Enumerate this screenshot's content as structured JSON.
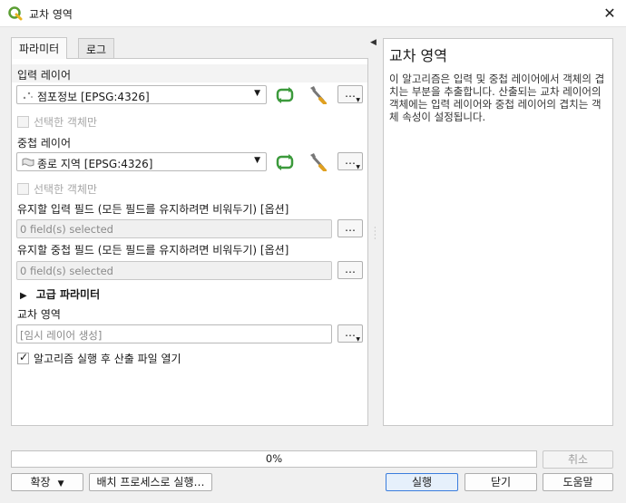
{
  "window": {
    "title": "교차 영역",
    "close_label": "✕"
  },
  "tabs": [
    {
      "label": "파라미터",
      "active": true
    },
    {
      "label": "로그",
      "active": false
    }
  ],
  "params": {
    "input_layer_label": "입력 레이어",
    "input_layer_value": "점포정보 [EPSG:4326]",
    "selected_only_label": "선택한 객체만",
    "overlay_layer_label": "중첩 레이어",
    "overlay_layer_value": "종로 지역 [EPSG:4326]",
    "input_fields_label": "유지할 입력 필드 (모든 필드를 유지하려면 비워두기) [옵션]",
    "input_fields_value": "0 field(s) selected",
    "overlay_fields_label": "유지할 중첩 필드 (모든 필드를 유지하려면 비워두기) [옵션]",
    "overlay_fields_value": "0 field(s) selected",
    "advanced_label": "고급 파라미터",
    "output_label": "교차 영역",
    "output_placeholder": "[임시 레이어 생성]",
    "open_after_label": "알고리즘 실행 후 산출 파일 열기",
    "ellipsis": "…"
  },
  "help": {
    "title": "교차 영역",
    "body": "이 알고리즘은 입력 및 중첩 레이어에서 객체의 겹치는 부분을 추출합니다. 산출되는 교차 레이어의 객체에는 입력 레이어와 중첩 레이어의 겹치는 객체 속성이 설정됩니다."
  },
  "progress": {
    "value": 0,
    "text": "0%"
  },
  "buttons": {
    "cancel": "취소",
    "expand": "확장",
    "batch": "배치 프로세스로 실행…",
    "run": "실행",
    "close": "닫기",
    "help": "도움말"
  },
  "colors": {
    "iterate_green": "#3c9a3c",
    "accent": "#3b7ddd"
  }
}
